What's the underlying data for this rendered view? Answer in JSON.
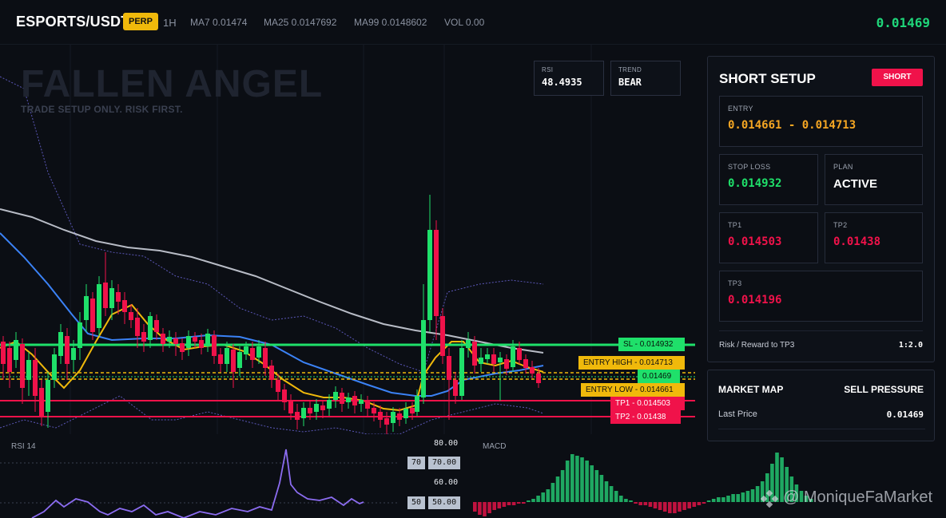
{
  "header": {
    "symbol": "ESPORTS/USDT",
    "badge": "PERP",
    "timeframe": "1H",
    "ma7": "MA7 0.01474",
    "ma25": "MA25 0.0147692",
    "ma99": "MA99 0.0148602",
    "vol": "VOL 0.00",
    "price": "0.01469"
  },
  "chart": {
    "watermark_title": "FALLEN ANGEL",
    "watermark_sub": "TRADE SETUP ONLY. RISK FIRST.",
    "rsi_box": {
      "label": "RSI",
      "value": "48.4935"
    },
    "trend_box": {
      "label": "TREND",
      "value": "BEAR"
    },
    "levels": {
      "sl": "SL - 0.014932",
      "entry_high": "ENTRY HIGH - 0.014713",
      "last": "0.01469",
      "entry_low": "ENTRY LOW - 0.014661",
      "tp1": "TP1 - 0.014503",
      "tp2": "TP2 - 0.01438"
    },
    "colors": {
      "up": "#1fe06a",
      "down": "#f0124a",
      "ma7": "#f0b90b",
      "ma25": "#3b82f6",
      "ma99": "#b8bcc6"
    }
  },
  "rsi_pane": {
    "label": "RSI 14",
    "ticks": [
      "80.00",
      "60.00"
    ],
    "tags": [
      "70",
      "70.00",
      "50",
      "50.00"
    ]
  },
  "macd_pane": {
    "label": "MACD"
  },
  "credit": {
    "text": "@ MoniqueFaMarket"
  },
  "panel": {
    "title": "SHORT SETUP",
    "badge": "SHORT",
    "entry": {
      "label": "ENTRY",
      "value": "0.014661 - 0.014713"
    },
    "stop_loss": {
      "label": "STOP LOSS",
      "value": "0.014932"
    },
    "plan": {
      "label": "PLAN",
      "value": "ACTIVE"
    },
    "tp1": {
      "label": "TP1",
      "value": "0.014503"
    },
    "tp2": {
      "label": "TP2",
      "value": "0.01438"
    },
    "tp3": {
      "label": "TP3",
      "value": "0.014196"
    },
    "rr_label": "Risk / Reward to TP3",
    "rr_value": "1:2.0"
  },
  "market_map": {
    "title": "MARKET MAP",
    "pressure": "SELL PRESSURE",
    "last_label": "Last Price",
    "last_value": "0.01469"
  }
}
